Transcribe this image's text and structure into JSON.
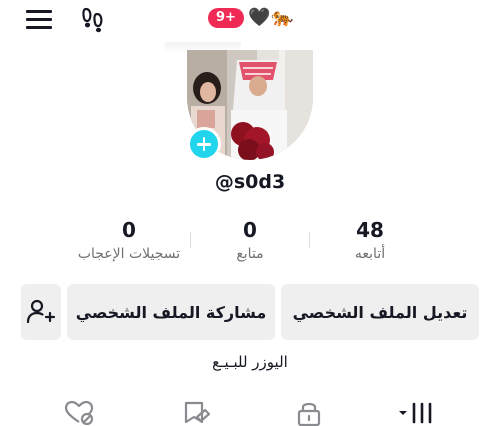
{
  "header": {
    "notification_count": "9+",
    "title_emoji": "🖤🐅"
  },
  "profile": {
    "username": "@s0d3",
    "bio": "اليوزر للبـيـع"
  },
  "stats": [
    {
      "value": "48",
      "label": "أتابعه"
    },
    {
      "value": "0",
      "label": "متابع"
    },
    {
      "value": "0",
      "label": "تسجيلات الإعجاب"
    }
  ],
  "actions": {
    "edit_profile": "تعديل الملف الشخصي",
    "share_profile": "مشاركة الملف الشخصي"
  },
  "icons": {
    "menu": "menu-icon",
    "footprint": "footprints-icon",
    "add_avatar": "plus-icon",
    "add_friend": "add-friend-icon",
    "tab_videos": "grid-icon",
    "tab_private": "lock-icon",
    "tab_favorites": "bookmark-icon",
    "tab_liked": "heart-icon"
  },
  "colors": {
    "accent": "#20d5ec",
    "badge": "#ee2a55",
    "button_bg": "#efefef",
    "text": "#161823",
    "muted": "#707070"
  }
}
